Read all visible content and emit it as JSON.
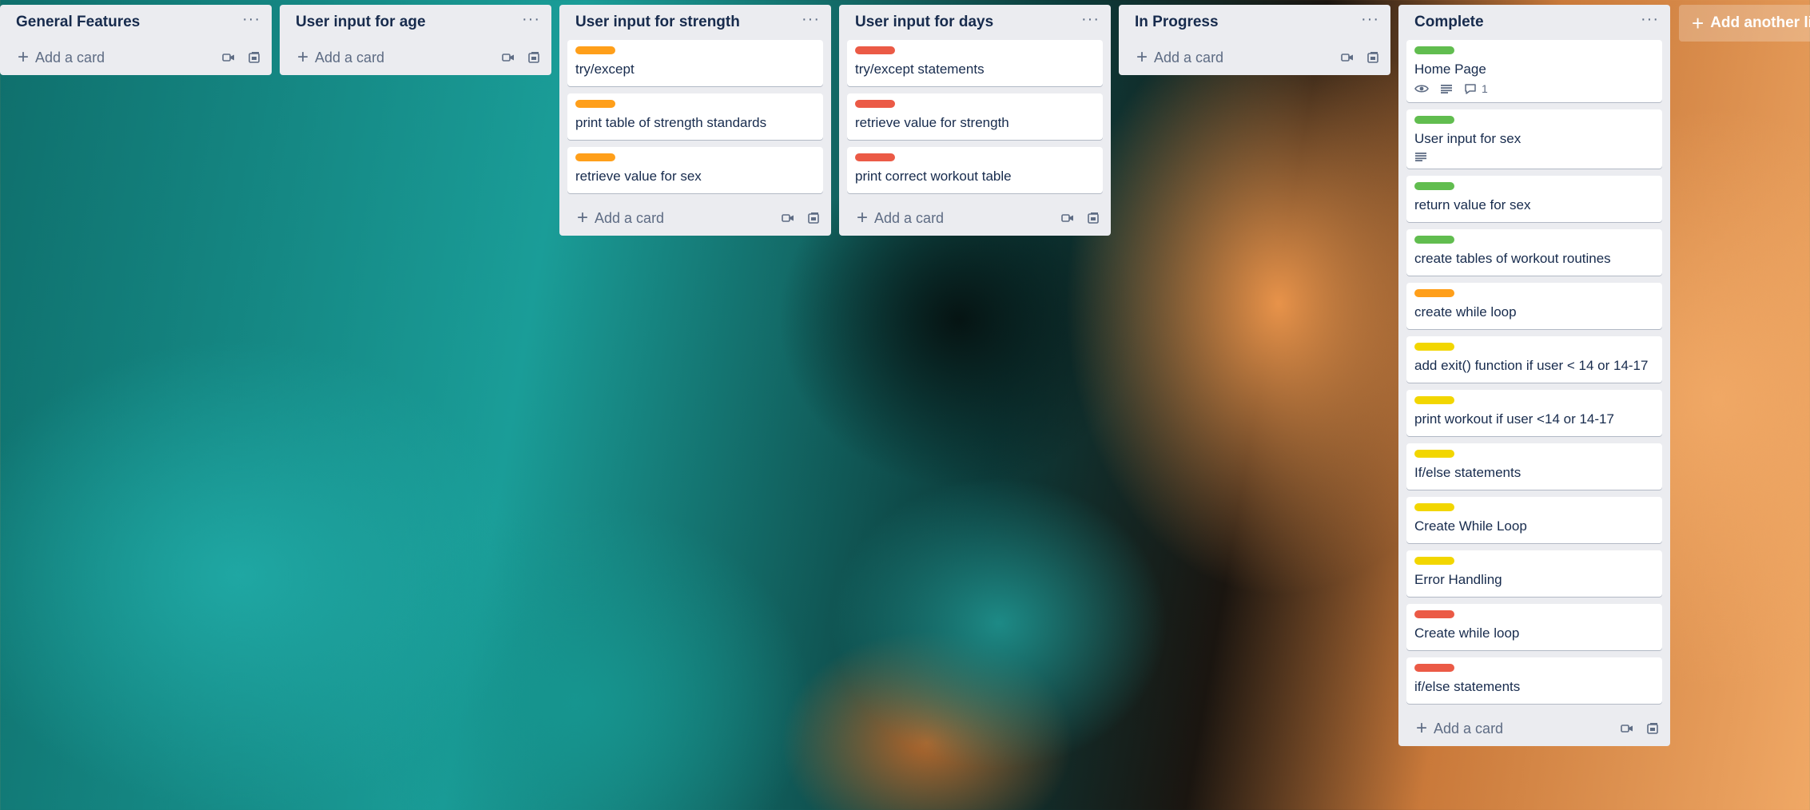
{
  "colors": {
    "green": "#61bd4f",
    "orange": "#ff9f1a",
    "red": "#eb5a46",
    "yellow": "#f2d600"
  },
  "add_card_label": "Add a card",
  "list_menu": "···",
  "add_list_label": "Add another list",
  "lists": [
    {
      "title": "General Features",
      "cards": []
    },
    {
      "title": "User input for age",
      "cards": []
    },
    {
      "title": "User input for strength",
      "cards": [
        {
          "label": "orange",
          "title": "try/except"
        },
        {
          "label": "orange",
          "title": "print table of strength standards"
        },
        {
          "label": "orange",
          "title": "retrieve value for sex"
        }
      ]
    },
    {
      "title": "User input for days",
      "cards": [
        {
          "label": "red",
          "title": "try/except statements"
        },
        {
          "label": "red",
          "title": "retrieve value for strength"
        },
        {
          "label": "red",
          "title": "print correct workout table"
        }
      ]
    },
    {
      "title": "In Progress",
      "cards": []
    },
    {
      "title": "Complete",
      "cards": [
        {
          "label": "green",
          "title": "Home Page",
          "badges": {
            "watch": true,
            "description": true,
            "comments": "1"
          }
        },
        {
          "label": "green",
          "title": "User input for sex",
          "badges": {
            "description": true
          }
        },
        {
          "label": "green",
          "title": "return value for sex"
        },
        {
          "label": "green",
          "title": "create tables of workout routines"
        },
        {
          "label": "orange",
          "title": "create while loop"
        },
        {
          "label": "yellow",
          "title": "add exit() function if user < 14 or 14-17"
        },
        {
          "label": "yellow",
          "title": "print workout if user <14 or 14-17"
        },
        {
          "label": "yellow",
          "title": "If/else statements"
        },
        {
          "label": "yellow",
          "title": "Create While Loop"
        },
        {
          "label": "yellow",
          "title": "Error Handling"
        },
        {
          "label": "red",
          "title": "Create while loop"
        },
        {
          "label": "red",
          "title": "if/else statements"
        }
      ]
    }
  ]
}
